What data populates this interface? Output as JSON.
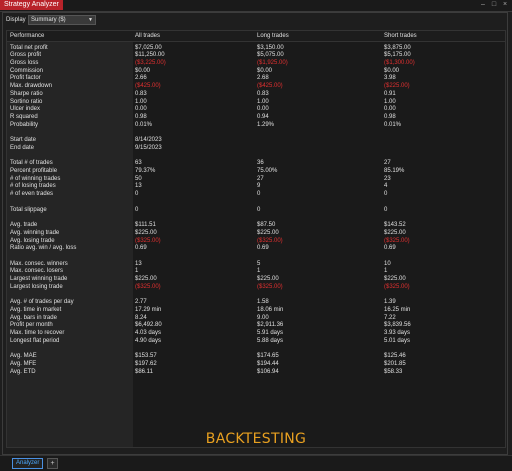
{
  "window": {
    "title": "Strategy Analyzer"
  },
  "display": {
    "label": "Display",
    "selected": "Summary ($)"
  },
  "columns": [
    "Performance",
    "All trades",
    "Long trades",
    "Short trades"
  ],
  "rows": [
    {
      "label": "Total net profit",
      "vals": [
        "$7,025.00",
        "$3,150.00",
        "$3,875.00"
      ],
      "neg": false
    },
    {
      "label": "Gross profit",
      "vals": [
        "$11,250.00",
        "$5,075.00",
        "$5,175.00"
      ],
      "neg": false
    },
    {
      "label": "Gross loss",
      "vals": [
        "($3,225.00)",
        "($1,925.00)",
        "($1,300.00)"
      ],
      "neg": true
    },
    {
      "label": "Commission",
      "vals": [
        "$0.00",
        "$0.00",
        "$0.00"
      ],
      "neg": false
    },
    {
      "label": "Profit factor",
      "vals": [
        "2.66",
        "2.68",
        "3.98"
      ],
      "neg": false
    },
    {
      "label": "Max. drawdown",
      "vals": [
        "($425.00)",
        "($425.00)",
        "($225.00)"
      ],
      "neg": true
    },
    {
      "label": "Sharpe ratio",
      "vals": [
        "0.83",
        "0.83",
        "0.91"
      ],
      "neg": false
    },
    {
      "label": "Sortino ratio",
      "vals": [
        "1.00",
        "1.00",
        "1.00"
      ],
      "neg": false
    },
    {
      "label": "Ulcer index",
      "vals": [
        "0.00",
        "0.00",
        "0.00"
      ],
      "neg": false
    },
    {
      "label": "R squared",
      "vals": [
        "0.98",
        "0.94",
        "0.98"
      ],
      "neg": false
    },
    {
      "label": "Probability",
      "vals": [
        "0.01%",
        "1.29%",
        "0.01%"
      ],
      "neg": false
    },
    null,
    {
      "label": "Start date",
      "vals": [
        "8/14/2023",
        "",
        ""
      ],
      "neg": false
    },
    {
      "label": "End date",
      "vals": [
        "9/15/2023",
        "",
        ""
      ],
      "neg": false
    },
    null,
    {
      "label": "Total # of trades",
      "vals": [
        "63",
        "36",
        "27"
      ],
      "neg": false
    },
    {
      "label": "Percent profitable",
      "vals": [
        "79.37%",
        "75.00%",
        "85.19%"
      ],
      "neg": false
    },
    {
      "label": "# of winning trades",
      "vals": [
        "50",
        "27",
        "23"
      ],
      "neg": false
    },
    {
      "label": "# of losing trades",
      "vals": [
        "13",
        "9",
        "4"
      ],
      "neg": false
    },
    {
      "label": "# of even trades",
      "vals": [
        "0",
        "0",
        "0"
      ],
      "neg": false
    },
    null,
    {
      "label": "Total slippage",
      "vals": [
        "0",
        "0",
        "0"
      ],
      "neg": false
    },
    null,
    {
      "label": "Avg. trade",
      "vals": [
        "$111.51",
        "$87.50",
        "$143.52"
      ],
      "neg": false
    },
    {
      "label": "Avg. winning trade",
      "vals": [
        "$225.00",
        "$225.00",
        "$225.00"
      ],
      "neg": false
    },
    {
      "label": "Avg. losing trade",
      "vals": [
        "($325.00)",
        "($325.00)",
        "($325.00)"
      ],
      "neg": true
    },
    {
      "label": "Ratio avg. win / avg. loss",
      "vals": [
        "0.69",
        "0.69",
        "0.69"
      ],
      "neg": false
    },
    null,
    {
      "label": "Max. consec. winners",
      "vals": [
        "13",
        "5",
        "10"
      ],
      "neg": false
    },
    {
      "label": "Max. consec. losers",
      "vals": [
        "1",
        "1",
        "1"
      ],
      "neg": false
    },
    {
      "label": "Largest winning trade",
      "vals": [
        "$225.00",
        "$225.00",
        "$225.00"
      ],
      "neg": false
    },
    {
      "label": "Largest losing trade",
      "vals": [
        "($325.00)",
        "($325.00)",
        "($325.00)"
      ],
      "neg": true
    },
    null,
    {
      "label": "Avg. # of trades per day",
      "vals": [
        "2.77",
        "1.58",
        "1.39"
      ],
      "neg": false
    },
    {
      "label": "Avg. time in market",
      "vals": [
        "17.29 min",
        "18.06 min",
        "16.25 min"
      ],
      "neg": false
    },
    {
      "label": "Avg. bars in trade",
      "vals": [
        "8.24",
        "9.00",
        "7.22"
      ],
      "neg": false
    },
    {
      "label": "Profit per month",
      "vals": [
        "$6,492.80",
        "$2,911.36",
        "$3,839.56"
      ],
      "neg": false
    },
    {
      "label": "Max. time to recover",
      "vals": [
        "4.03 days",
        "5.91 days",
        "3.93 days"
      ],
      "neg": false
    },
    {
      "label": "Longest flat period",
      "vals": [
        "4.90 days",
        "5.88 days",
        "5.01 days"
      ],
      "neg": false
    },
    null,
    {
      "label": "Avg. MAE",
      "vals": [
        "$153.57",
        "$174.65",
        "$125.46"
      ],
      "neg": false
    },
    {
      "label": "Avg. MFE",
      "vals": [
        "$197.62",
        "$194.44",
        "$201.85"
      ],
      "neg": false
    },
    {
      "label": "Avg. ETD",
      "vals": [
        "$86.11",
        "$106.94",
        "$58.33"
      ],
      "neg": false
    }
  ],
  "overlay": {
    "text": "BACKTESTING"
  },
  "bottom_tabs": [
    {
      "label": "Analyzer"
    }
  ],
  "add_tab_label": "+",
  "colors": {
    "title_bg": "#b8232a",
    "negative": "#e03030",
    "overlay": "#e8a020",
    "tab_accent": "#4a90e2"
  }
}
